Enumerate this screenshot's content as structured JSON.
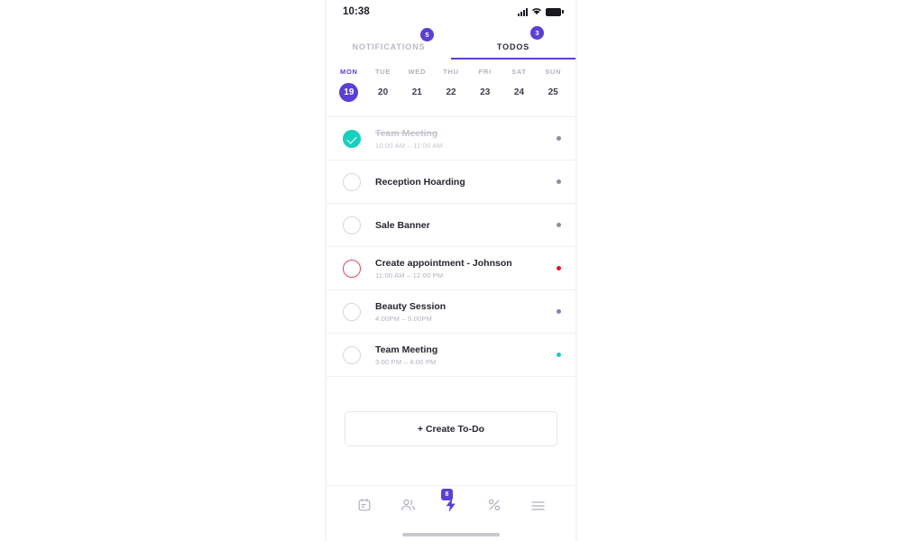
{
  "status_bar": {
    "time": "10:38",
    "signal_icon": "signal-bars-icon",
    "wifi_icon": "wifi-icon",
    "battery_icon": "battery-icon"
  },
  "tabs": [
    {
      "label": "NOTIFICATIONS",
      "badge": "5",
      "active": false
    },
    {
      "label": "TODOS",
      "badge": "3",
      "active": true
    }
  ],
  "week_strip": {
    "days": [
      {
        "dow": "MON",
        "num": "19",
        "selected": true
      },
      {
        "dow": "TUE",
        "num": "20",
        "selected": false
      },
      {
        "dow": "WED",
        "num": "21",
        "selected": false
      },
      {
        "dow": "THU",
        "num": "22",
        "selected": false
      },
      {
        "dow": "FRI",
        "num": "23",
        "selected": false
      },
      {
        "dow": "SAT",
        "num": "24",
        "selected": false
      },
      {
        "dow": "SUN",
        "num": "25",
        "selected": false
      }
    ]
  },
  "tasks": [
    {
      "title": "Team Meeting",
      "time": "10:00 AM – 11:00 AM",
      "completed": true,
      "urgent": false,
      "dot_color": "#8f8d9e"
    },
    {
      "title": "Reception Hoarding",
      "time": "",
      "completed": false,
      "urgent": false,
      "dot_color": "#8f8d9e"
    },
    {
      "title": "Sale Banner",
      "time": "",
      "completed": false,
      "urgent": false,
      "dot_color": "#8f8d9e"
    },
    {
      "title": "Create appointment - Johnson",
      "time": "11:00 AM – 12:00 PM",
      "completed": false,
      "urgent": true,
      "dot_color": "#e0162b"
    },
    {
      "title": "Beauty Session",
      "time": "4:00PM – 5:00PM",
      "completed": false,
      "urgent": false,
      "dot_color": "#8580b0"
    },
    {
      "title": "Team Meeting",
      "time": "3:00 PM – 4:00 PM",
      "completed": false,
      "urgent": false,
      "dot_color": "#17cfbd"
    }
  ],
  "create_button": {
    "label": "+ Create To-Do"
  },
  "bottom_nav": {
    "items": [
      {
        "icon": "calendar-note-icon",
        "active": false,
        "badge": ""
      },
      {
        "icon": "people-icon",
        "active": false,
        "badge": ""
      },
      {
        "icon": "lightning-bolt-icon",
        "active": true,
        "badge": "8"
      },
      {
        "icon": "percent-icon",
        "active": false,
        "badge": ""
      },
      {
        "icon": "hamburger-menu-icon",
        "active": false,
        "badge": ""
      }
    ]
  },
  "colors": {
    "accent_purple": "#5b3fd4",
    "teal": "#17cfbd",
    "urgent_red": "#d8485e",
    "text_dark": "#26252f",
    "text_muted": "#b3b1bf"
  }
}
